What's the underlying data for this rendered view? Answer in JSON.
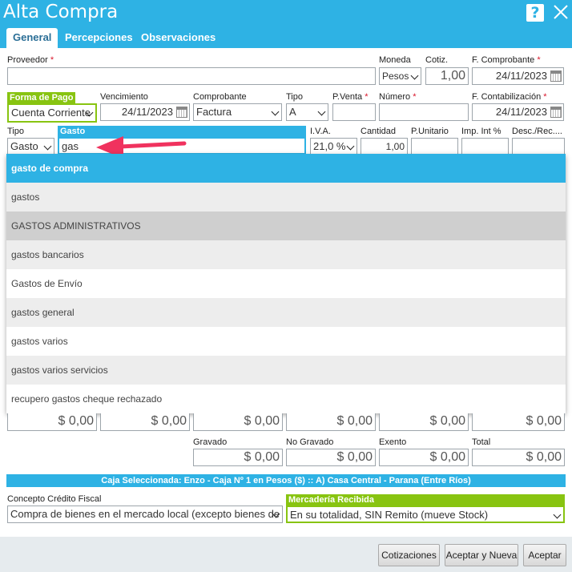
{
  "window": {
    "title": "Alta Compra"
  },
  "tabs": [
    {
      "label": "General",
      "active": true
    },
    {
      "label": "Percepciones",
      "active": false
    },
    {
      "label": "Observaciones",
      "active": false
    }
  ],
  "header": {
    "proveedor": {
      "label": "Proveedor",
      "required": "*",
      "value": ""
    },
    "moneda": {
      "label": "Moneda",
      "value": "Pesos"
    },
    "cotiz": {
      "label": "Cotiz.",
      "value": "1,00"
    },
    "f_comprobante": {
      "label": "F. Comprobante",
      "required": "*",
      "value": "24/11/2023"
    },
    "forma_pago": {
      "label": "Forma de Pago",
      "value": "Cuenta Corriente"
    },
    "vencimiento": {
      "label": "Vencimiento",
      "value": "24/11/2023"
    },
    "comprobante": {
      "label": "Comprobante",
      "value": "Factura"
    },
    "tipo": {
      "label": "Tipo",
      "value": "A"
    },
    "pventa": {
      "label": "P.Venta",
      "required": "*",
      "value": ""
    },
    "numero": {
      "label": "Número",
      "required": "*",
      "value": ""
    },
    "f_contabilizacion": {
      "label": "F. Contabilización",
      "required": "*",
      "value": "24/11/2023"
    }
  },
  "item_row": {
    "tipo": {
      "label": "Tipo",
      "value": "Gasto"
    },
    "gasto": {
      "label": "Gasto",
      "value": "gas"
    },
    "iva": {
      "label": "I.V.A.",
      "value": "21,0 %"
    },
    "cantidad": {
      "label": "Cantidad",
      "value": "1,00"
    },
    "punitario": {
      "label": "P.Unitario",
      "value": ""
    },
    "imp_int": {
      "label": "Imp. Int %",
      "value": ""
    },
    "desc_rec": {
      "label": "Desc./Rec....",
      "value": ""
    }
  },
  "autocomplete": [
    {
      "label": "gasto de compra",
      "state": "selected"
    },
    {
      "label": "gastos",
      "state": "grey"
    },
    {
      "label": "GASTOS ADMINISTRATIVOS",
      "state": "dark"
    },
    {
      "label": "gastos bancarios",
      "state": "grey"
    },
    {
      "label": "Gastos de Envío",
      "state": "white"
    },
    {
      "label": "gastos general",
      "state": "grey"
    },
    {
      "label": "gastos varios",
      "state": "white"
    },
    {
      "label": "gastos varios servicios",
      "state": "grey"
    },
    {
      "label": "recupero gastos cheque rechazado",
      "state": "white"
    }
  ],
  "totals_row1": [
    "$ 0,00",
    "$ 0,00",
    "$ 0,00",
    "$ 0,00",
    "$ 0,00",
    "$ 0,00"
  ],
  "totals": {
    "gravado": {
      "label": "Gravado",
      "value": "$ 0,00"
    },
    "no_gravado": {
      "label": "No Gravado",
      "value": "$ 0,00"
    },
    "exento": {
      "label": "Exento",
      "value": "$ 0,00"
    },
    "total": {
      "label": "Total",
      "value": "$ 0,00"
    }
  },
  "caja": "Caja Seleccionada: Enzo - Caja Nº 1 en Pesos ($) :: A) Casa Central - Parana (Entre Ríos)",
  "concepto": {
    "label": "Concepto Crédito Fiscal",
    "value": "Compra de bienes en el mercado local (excepto bienes de uso)"
  },
  "mercaderia": {
    "label": "Mercadería Recibida",
    "value": "En su totalidad, SIN Remito (mueve Stock)"
  },
  "buttons": {
    "cotizaciones": "Cotizaciones",
    "aceptar_nueva": "Aceptar y Nueva",
    "aceptar": "Aceptar"
  },
  "colors": {
    "accent": "#2eb2e4",
    "green": "#88c411",
    "required": "#d9162a",
    "arrow": "#f0325e"
  }
}
